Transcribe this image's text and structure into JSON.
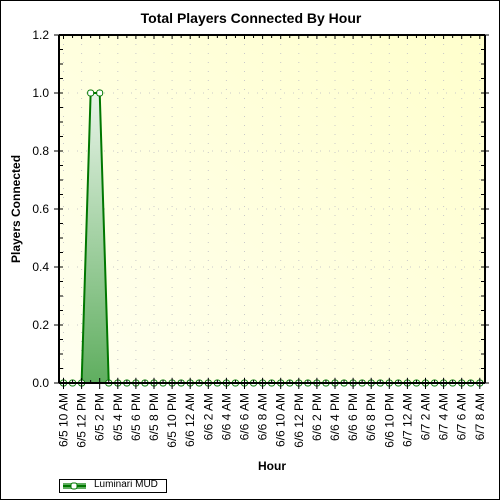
{
  "chart_data": {
    "type": "area",
    "title": "Total Players Connected By Hour",
    "xlabel": "Hour",
    "ylabel": "Players Connected",
    "ylim": [
      0,
      1.2
    ],
    "y_ticks": [
      "0.0",
      "0.2",
      "0.4",
      "0.6",
      "0.8",
      "1.0",
      "1.2"
    ],
    "y_tick_values": [
      0,
      0.2,
      0.4,
      0.6,
      0.8,
      1.0,
      1.2
    ],
    "y_minor_per_major": 4,
    "grid": true,
    "legend": {
      "position": "bottom-left",
      "entries": [
        "Luminari MUD"
      ]
    },
    "x_tick_labels": [
      "6/5 10 AM",
      "6/5 12 PM",
      "6/5 2 PM",
      "6/5 4 PM",
      "6/5 6 PM",
      "6/5 8 PM",
      "6/5 10 PM",
      "6/6 12 AM",
      "6/6 2 AM",
      "6/6 4 AM",
      "6/6 6 AM",
      "6/6 8 AM",
      "6/6 10 AM",
      "6/6 12 PM",
      "6/6 2 PM",
      "6/6 4 PM",
      "6/6 6 PM",
      "6/6 8 PM",
      "6/6 10 PM",
      "6/7 12 AM",
      "6/7 2 AM",
      "6/7 4 AM",
      "6/7 6 AM",
      "6/7 8 AM"
    ],
    "x_label_every_hours": 2,
    "series": [
      {
        "name": "Luminari MUD",
        "color": "#007700",
        "fill_top": "#e8f4e8",
        "fill_bottom": "#5fae5f",
        "start": "6/5 10 AM",
        "interval_hours": 1,
        "values": [
          0,
          0,
          0,
          1,
          1,
          0,
          0,
          0,
          0,
          0,
          0,
          0,
          0,
          0,
          0,
          0,
          0,
          0,
          0,
          0,
          0,
          0,
          0,
          0,
          0,
          0,
          0,
          0,
          0,
          0,
          0,
          0,
          0,
          0,
          0,
          0,
          0,
          0,
          0,
          0,
          0,
          0,
          0,
          0,
          0,
          0,
          0
        ]
      }
    ]
  },
  "colors": {
    "plot_bg_left": "#fffff0",
    "plot_bg_right": "#ffffcc",
    "grid_dot": "#c8c8c8"
  }
}
